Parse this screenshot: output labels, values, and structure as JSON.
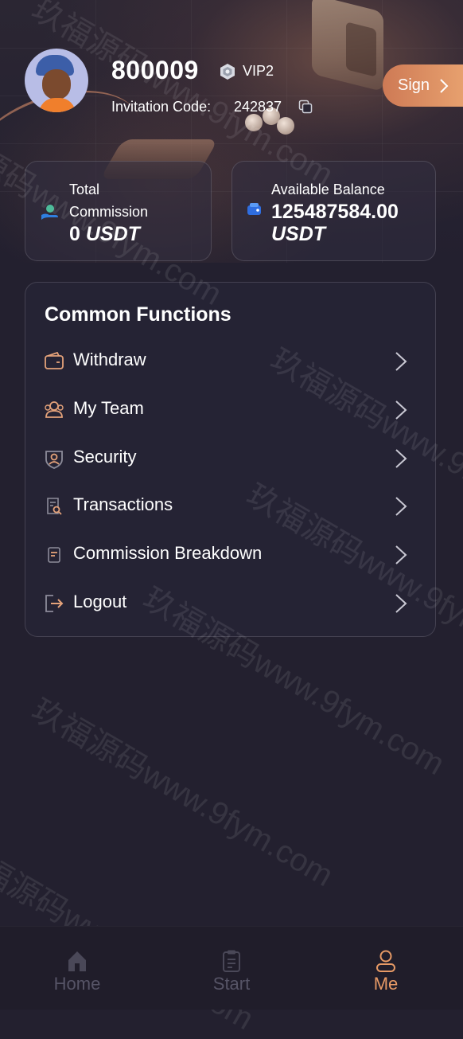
{
  "user": {
    "id": "800009",
    "vip_level": "VIP2",
    "invitation_label": "Invitation Code:",
    "invitation_code": "242837"
  },
  "header": {
    "sign_label": "Sign"
  },
  "stats": {
    "total_commission": {
      "title_line1": "Total",
      "title_line2": "Commission",
      "value": "0",
      "unit": "USDT"
    },
    "available_balance": {
      "title": "Available Balance",
      "value": "125487584.00",
      "unit": "USDT"
    }
  },
  "functions": {
    "title": "Common Functions",
    "items": [
      {
        "label": "Withdraw",
        "icon": "wallet-icon"
      },
      {
        "label": "My Team",
        "icon": "team-icon"
      },
      {
        "label": "Security",
        "icon": "shield-user-icon"
      },
      {
        "label": "Transactions",
        "icon": "document-search-icon"
      },
      {
        "label": "Commission Breakdown",
        "icon": "document-icon"
      },
      {
        "label": "Logout",
        "icon": "logout-icon"
      }
    ]
  },
  "tabbar": {
    "tabs": [
      {
        "label": "Home",
        "icon": "home-icon",
        "active": false
      },
      {
        "label": "Start",
        "icon": "clipboard-icon",
        "active": false
      },
      {
        "label": "Me",
        "icon": "person-icon",
        "active": true
      }
    ]
  },
  "watermark": {
    "text": "玖福源码www.9fym.com"
  },
  "colors": {
    "background": "#23202f",
    "accent": "#e79a66",
    "sign_gradient_start": "#ce7a55",
    "sign_gradient_end": "#e7a06e",
    "icon_accent": "#e4a27a",
    "tab_inactive": "#565466"
  }
}
